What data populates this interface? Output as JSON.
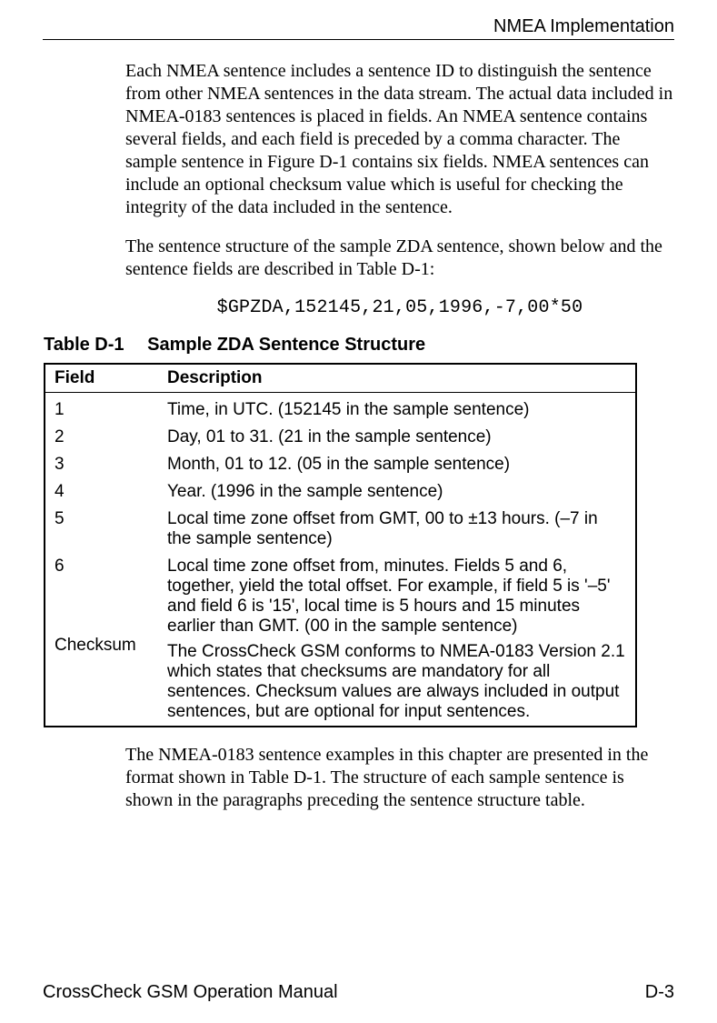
{
  "header": {
    "title": "NMEA Implementation"
  },
  "paragraphs": {
    "p1": "Each NMEA sentence includes a sentence ID to distinguish the sentence from other NMEA sentences in the data stream. The actual data included in NMEA-0183 sentences is placed in fields. An NMEA sentence contains several fields, and each field is preceded by a comma character. The sample sentence in Figure D-1 contains six fields. NMEA sentences can include an optional checksum value which is useful for checking the integrity of the data included in the sentence.",
    "p2": "The sentence structure of the sample ZDA sentence, shown below and the sentence fields are described in Table D-1:",
    "p3": "The NMEA-0183 sentence examples in this chapter are presented in the format shown in Table D-1. The structure of each sample sentence is shown in the paragraphs preceding the sentence structure table."
  },
  "code": "$GPZDA,152145,21,05,1996,-7,00*50",
  "table": {
    "caption_num": "Table D-1",
    "caption_title": "Sample ZDA Sentence Structure",
    "headers": {
      "field": "Field",
      "description": "Description"
    },
    "rows": [
      {
        "field": "1",
        "description": "Time, in UTC. (152145 in the sample sentence)"
      },
      {
        "field": "2",
        "description": "Day, 01 to 31. (21 in the sample sentence)"
      },
      {
        "field": "3",
        "description": "Month, 01 to 12. (05 in the sample sentence)"
      },
      {
        "field": "4",
        "description": "Year. (1996 in the sample sentence)"
      },
      {
        "field": "5",
        "description": "Local time zone offset from GMT, 00 to ±13 hours. (–7 in the sample sentence)"
      },
      {
        "field": "6",
        "description": "Local time zone offset from, minutes. Fields 5 and 6, together, yield the total offset. For example, if field 5 is '–5' and field 6 is '15', local time is 5 hours and 15 minutes earlier than GMT. (00 in the sample sentence)"
      },
      {
        "field": "Checksum",
        "description": "The CrossCheck GSM conforms to NMEA-0183 Version 2.1 which states that checksums are mandatory for all sentences. Checksum values are always included in output sentences, but are optional for input sentences."
      }
    ]
  },
  "footer": {
    "left": "CrossCheck GSM Operation Manual",
    "right": "D-3"
  }
}
